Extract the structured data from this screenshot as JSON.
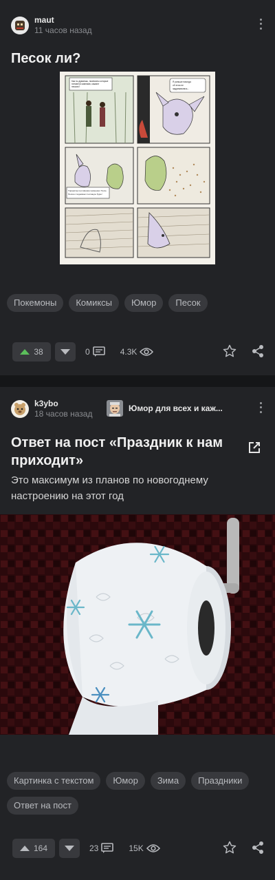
{
  "post1": {
    "author": "maut",
    "time": "11 часов назад",
    "title": "Песок ли?",
    "comic_caption_1": "Как ты думаешь, покемоны которые питаются камнями, кажают песком?",
    "comic_caption_2": "Я раньше никогда об этом не задумывалась...",
    "comic_caption_3": "Тиранитар противника применяет Пулю Песка и поднимает песчаную бурю!",
    "tags": [
      "Покемоны",
      "Комиксы",
      "Юмор",
      "Песок"
    ],
    "rating": "38",
    "comments": "0",
    "views": "4.3K",
    "vote_state": "up"
  },
  "post2": {
    "author": "k3ybo",
    "time": "18 часов назад",
    "community": "Юмор для всех и каж...",
    "title": "Ответ на пост «Праздник к нам приходит»",
    "description": "Это максимум из планов по новогоднему настроению на этот год",
    "tags": [
      "Картинка с текстом",
      "Юмор",
      "Зима",
      "Праздники",
      "Ответ на пост"
    ],
    "rating": "164",
    "comments": "23",
    "views": "15K"
  },
  "colors": {
    "background": "#222326",
    "separator": "#151618",
    "tag_bg": "#38393d",
    "upvote_active": "#5bbf5b"
  },
  "icons": [
    "kebab-menu-icon",
    "upvote-icon",
    "downvote-icon",
    "comment-icon",
    "eye-icon",
    "star-icon",
    "share-icon",
    "external-link-icon"
  ]
}
